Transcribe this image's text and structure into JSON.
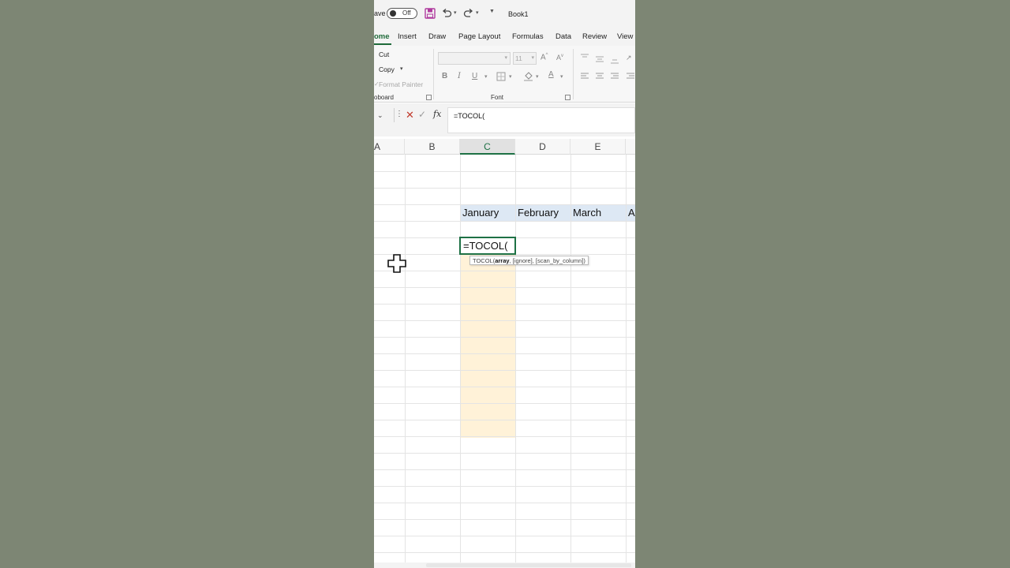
{
  "titlebar": {
    "autosave_label": "ave",
    "autosave_state": "Off",
    "document_title": "Book1"
  },
  "tabs": [
    {
      "label": "ome",
      "active": true
    },
    {
      "label": "Insert",
      "active": false
    },
    {
      "label": "Draw",
      "active": false
    },
    {
      "label": "Page Layout",
      "active": false
    },
    {
      "label": "Formulas",
      "active": false
    },
    {
      "label": "Data",
      "active": false
    },
    {
      "label": "Review",
      "active": false
    },
    {
      "label": "View",
      "active": false
    }
  ],
  "ribbon": {
    "clipboard": {
      "cut_label": "Cut",
      "copy_label": "Copy",
      "format_painter_label": "Format Painter",
      "group_label": "oboard"
    },
    "font": {
      "font_size": "11",
      "group_label": "Font"
    }
  },
  "formula_bar": {
    "formula": "=TOCOL("
  },
  "grid": {
    "columns": [
      "A",
      "B",
      "C",
      "D",
      "E"
    ],
    "selected_column": "C",
    "months": [
      "January",
      "February",
      "March",
      "A"
    ],
    "active_cell_text": "=TOCOL(",
    "tooltip": {
      "prefix": "TOCOL(",
      "bold_arg": "array",
      "rest": ", [ignore], [scan_by_column])"
    }
  },
  "colors": {
    "accent_green": "#1e7145",
    "month_band": "#dde8f4",
    "highlight_column": "#fff2d8",
    "background": "#7d8674"
  }
}
